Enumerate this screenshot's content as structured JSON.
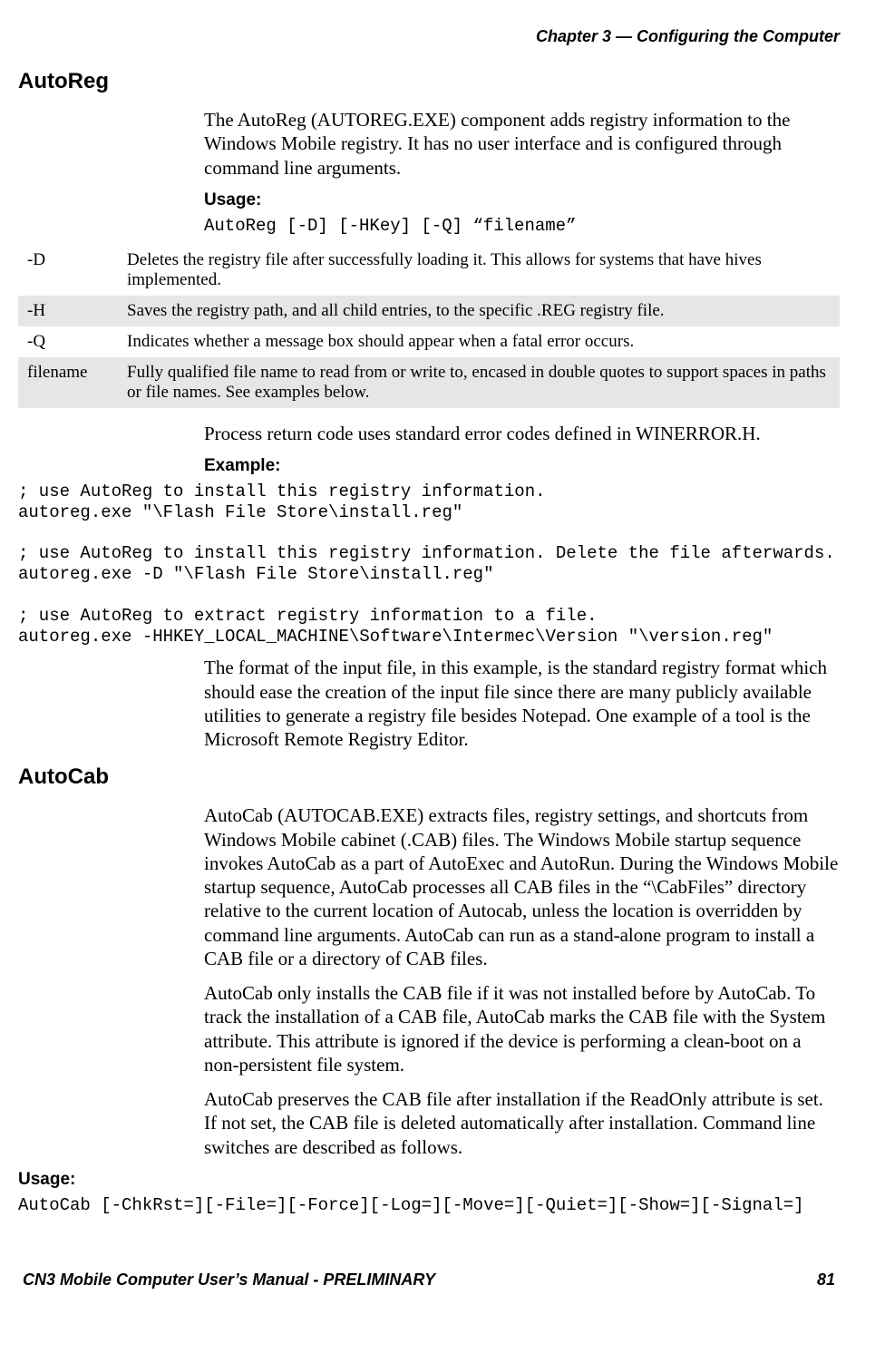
{
  "header": {
    "chapter": "Chapter 3 —  Configuring the Computer"
  },
  "autoreg": {
    "heading": "AutoReg",
    "intro": "The AutoReg (AUTOREG.EXE) component adds registry information to the Windows Mobile registry. It has no user interface and is configured through command line arguments.",
    "usage_label": "Usage:",
    "usage_code": "AutoReg [-D] [-HKey] [-Q] “filename”",
    "table": [
      {
        "key": "-D",
        "desc": "Deletes the registry file after successfully loading it. This allows for systems that have hives implemented."
      },
      {
        "key": "-H",
        "desc": "Saves the registry path, and all child entries, to the specific .REG registry file."
      },
      {
        "key": "-Q",
        "desc": "Indicates whether a message box should appear when a fatal error occurs."
      },
      {
        "key": "filename",
        "desc": "Fully qualified file name to read from or write to, encased in double quotes to support spaces in paths or file names. See examples below."
      }
    ],
    "after_table": "Process return code uses standard error codes defined in WINERROR.H.",
    "example_label": "Example:",
    "example_code": "; use AutoReg to install this registry information.\nautoreg.exe \"\\Flash File Store\\install.reg\"\n\n; use AutoReg to install this registry information. Delete the file afterwards.\nautoreg.exe -D \"\\Flash File Store\\install.reg\"\n\n; use AutoReg to extract registry information to a file.\nautoreg.exe -HHKEY_LOCAL_MACHINE\\Software\\Intermec\\Version \"\\version.reg\"",
    "after_example": "The format of the input file, in this example, is the standard registry format which should ease the creation of the input file since there are many publicly available utilities to generate a registry file besides Notepad. One example of a tool is the Microsoft Remote Registry Editor."
  },
  "autocab": {
    "heading": "AutoCab",
    "para1": "AutoCab (AUTOCAB.EXE) extracts files, registry settings, and shortcuts from Windows Mobile cabinet (.CAB) files. The Windows Mobile startup sequence invokes AutoCab as a part of AutoExec and AutoRun. During the Windows Mobile startup sequence, AutoCab processes all CAB files in the “\\CabFiles” directory relative to the current location of Autocab, unless the location is overridden by command line arguments. AutoCab can run as a stand-alone program to install a CAB file or a directory of CAB files.",
    "para2": "AutoCab only installs the CAB file if it was not installed before by AutoCab. To track the installation of a CAB file, AutoCab marks the CAB file with the System attribute. This attribute is ignored if the device is performing a clean-boot on a non-persistent file system.",
    "para3": "AutoCab preserves the CAB file after installation if the ReadOnly attribute is set. If not set, the CAB file is deleted automatically after installation. Command line switches are described as follows.",
    "usage_label": "Usage:",
    "usage_code": "AutoCab [-ChkRst=][-File=][-Force][-Log=][-Move=][-Quiet=][-Show=][-Signal=]"
  },
  "footer": {
    "left": "CN3 Mobile Computer User’s Manual - PRELIMINARY",
    "right": "81"
  }
}
